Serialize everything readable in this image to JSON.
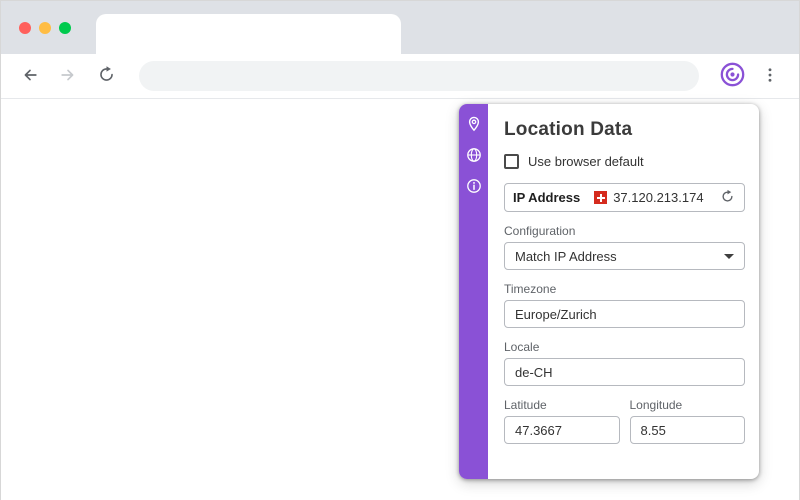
{
  "colors": {
    "accent": "#8a51d6",
    "flag_red": "#d52b1e",
    "toolbar_icon": "#5f6368"
  },
  "browser": {
    "tab_title": "",
    "address": {
      "value": "",
      "placeholder": ""
    }
  },
  "icons": {
    "toolbar": [
      "back-arrow-icon",
      "forward-arrow-icon",
      "reload-icon",
      "vytal-extension-icon",
      "kebab-menu-icon"
    ],
    "panel_sidebar": [
      "location-pin-icon",
      "globe-icon",
      "info-icon"
    ],
    "inline": [
      "swiss-flag-icon",
      "refresh-icon",
      "dropdown-caret-icon"
    ]
  },
  "panel": {
    "title": "Location Data",
    "browser_default": {
      "label": "Use browser default",
      "checked": false
    },
    "ip": {
      "label": "IP Address",
      "value": "37.120.213.174",
      "country": "CH"
    },
    "configuration": {
      "label": "Configuration",
      "value": "Match IP Address"
    },
    "timezone": {
      "label": "Timezone",
      "value": "Europe/Zurich"
    },
    "locale": {
      "label": "Locale",
      "value": "de-CH"
    },
    "latitude": {
      "label": "Latitude",
      "value": "47.3667"
    },
    "longitude": {
      "label": "Longitude",
      "value": "8.55"
    }
  }
}
